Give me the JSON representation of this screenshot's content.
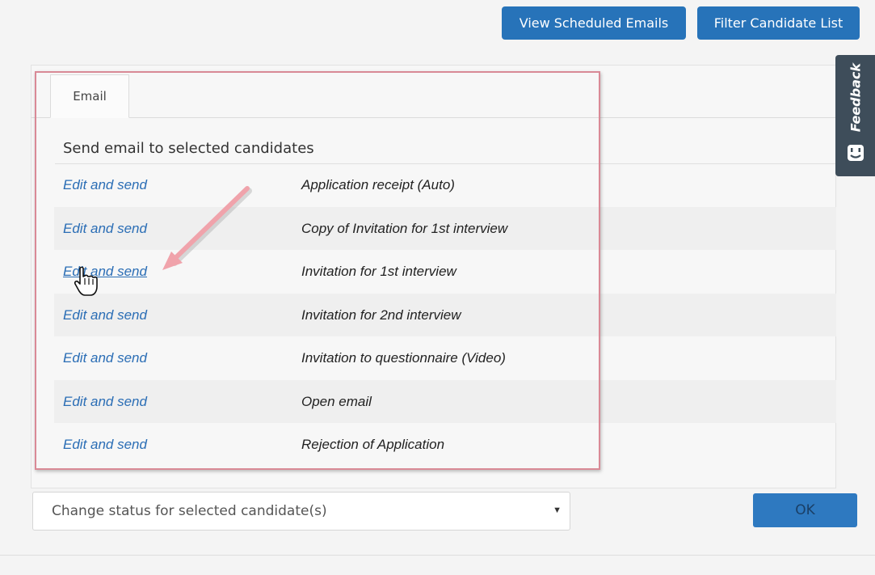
{
  "toolbar": {
    "view_scheduled_label": "View Scheduled Emails",
    "filter_label": "Filter Candidate List"
  },
  "tabs": [
    {
      "label": "Email",
      "active": true
    }
  ],
  "email_section": {
    "heading": "Send email to selected candidates",
    "rows": [
      {
        "action": "Edit and send",
        "template": "Application receipt (Auto)"
      },
      {
        "action": "Edit and send",
        "template": "Copy of Invitation for 1st interview"
      },
      {
        "action": "Edit and send",
        "template": "Invitation for 1st interview"
      },
      {
        "action": "Edit and send",
        "template": "Invitation for 2nd interview"
      },
      {
        "action": "Edit and send",
        "template": "Invitation to questionnaire (Video)"
      },
      {
        "action": "Edit and send",
        "template": "Open email"
      },
      {
        "action": "Edit and send",
        "template": "Rejection of Application"
      }
    ]
  },
  "feedback": {
    "label": "Feedback"
  },
  "status": {
    "selected": "Change status for selected candidate(s)",
    "ok_label": "OK"
  },
  "colors": {
    "primary": "#2773b9",
    "link": "#2a6db5",
    "highlight": "#d98a96",
    "feedback_bg": "#3e4d5a"
  }
}
